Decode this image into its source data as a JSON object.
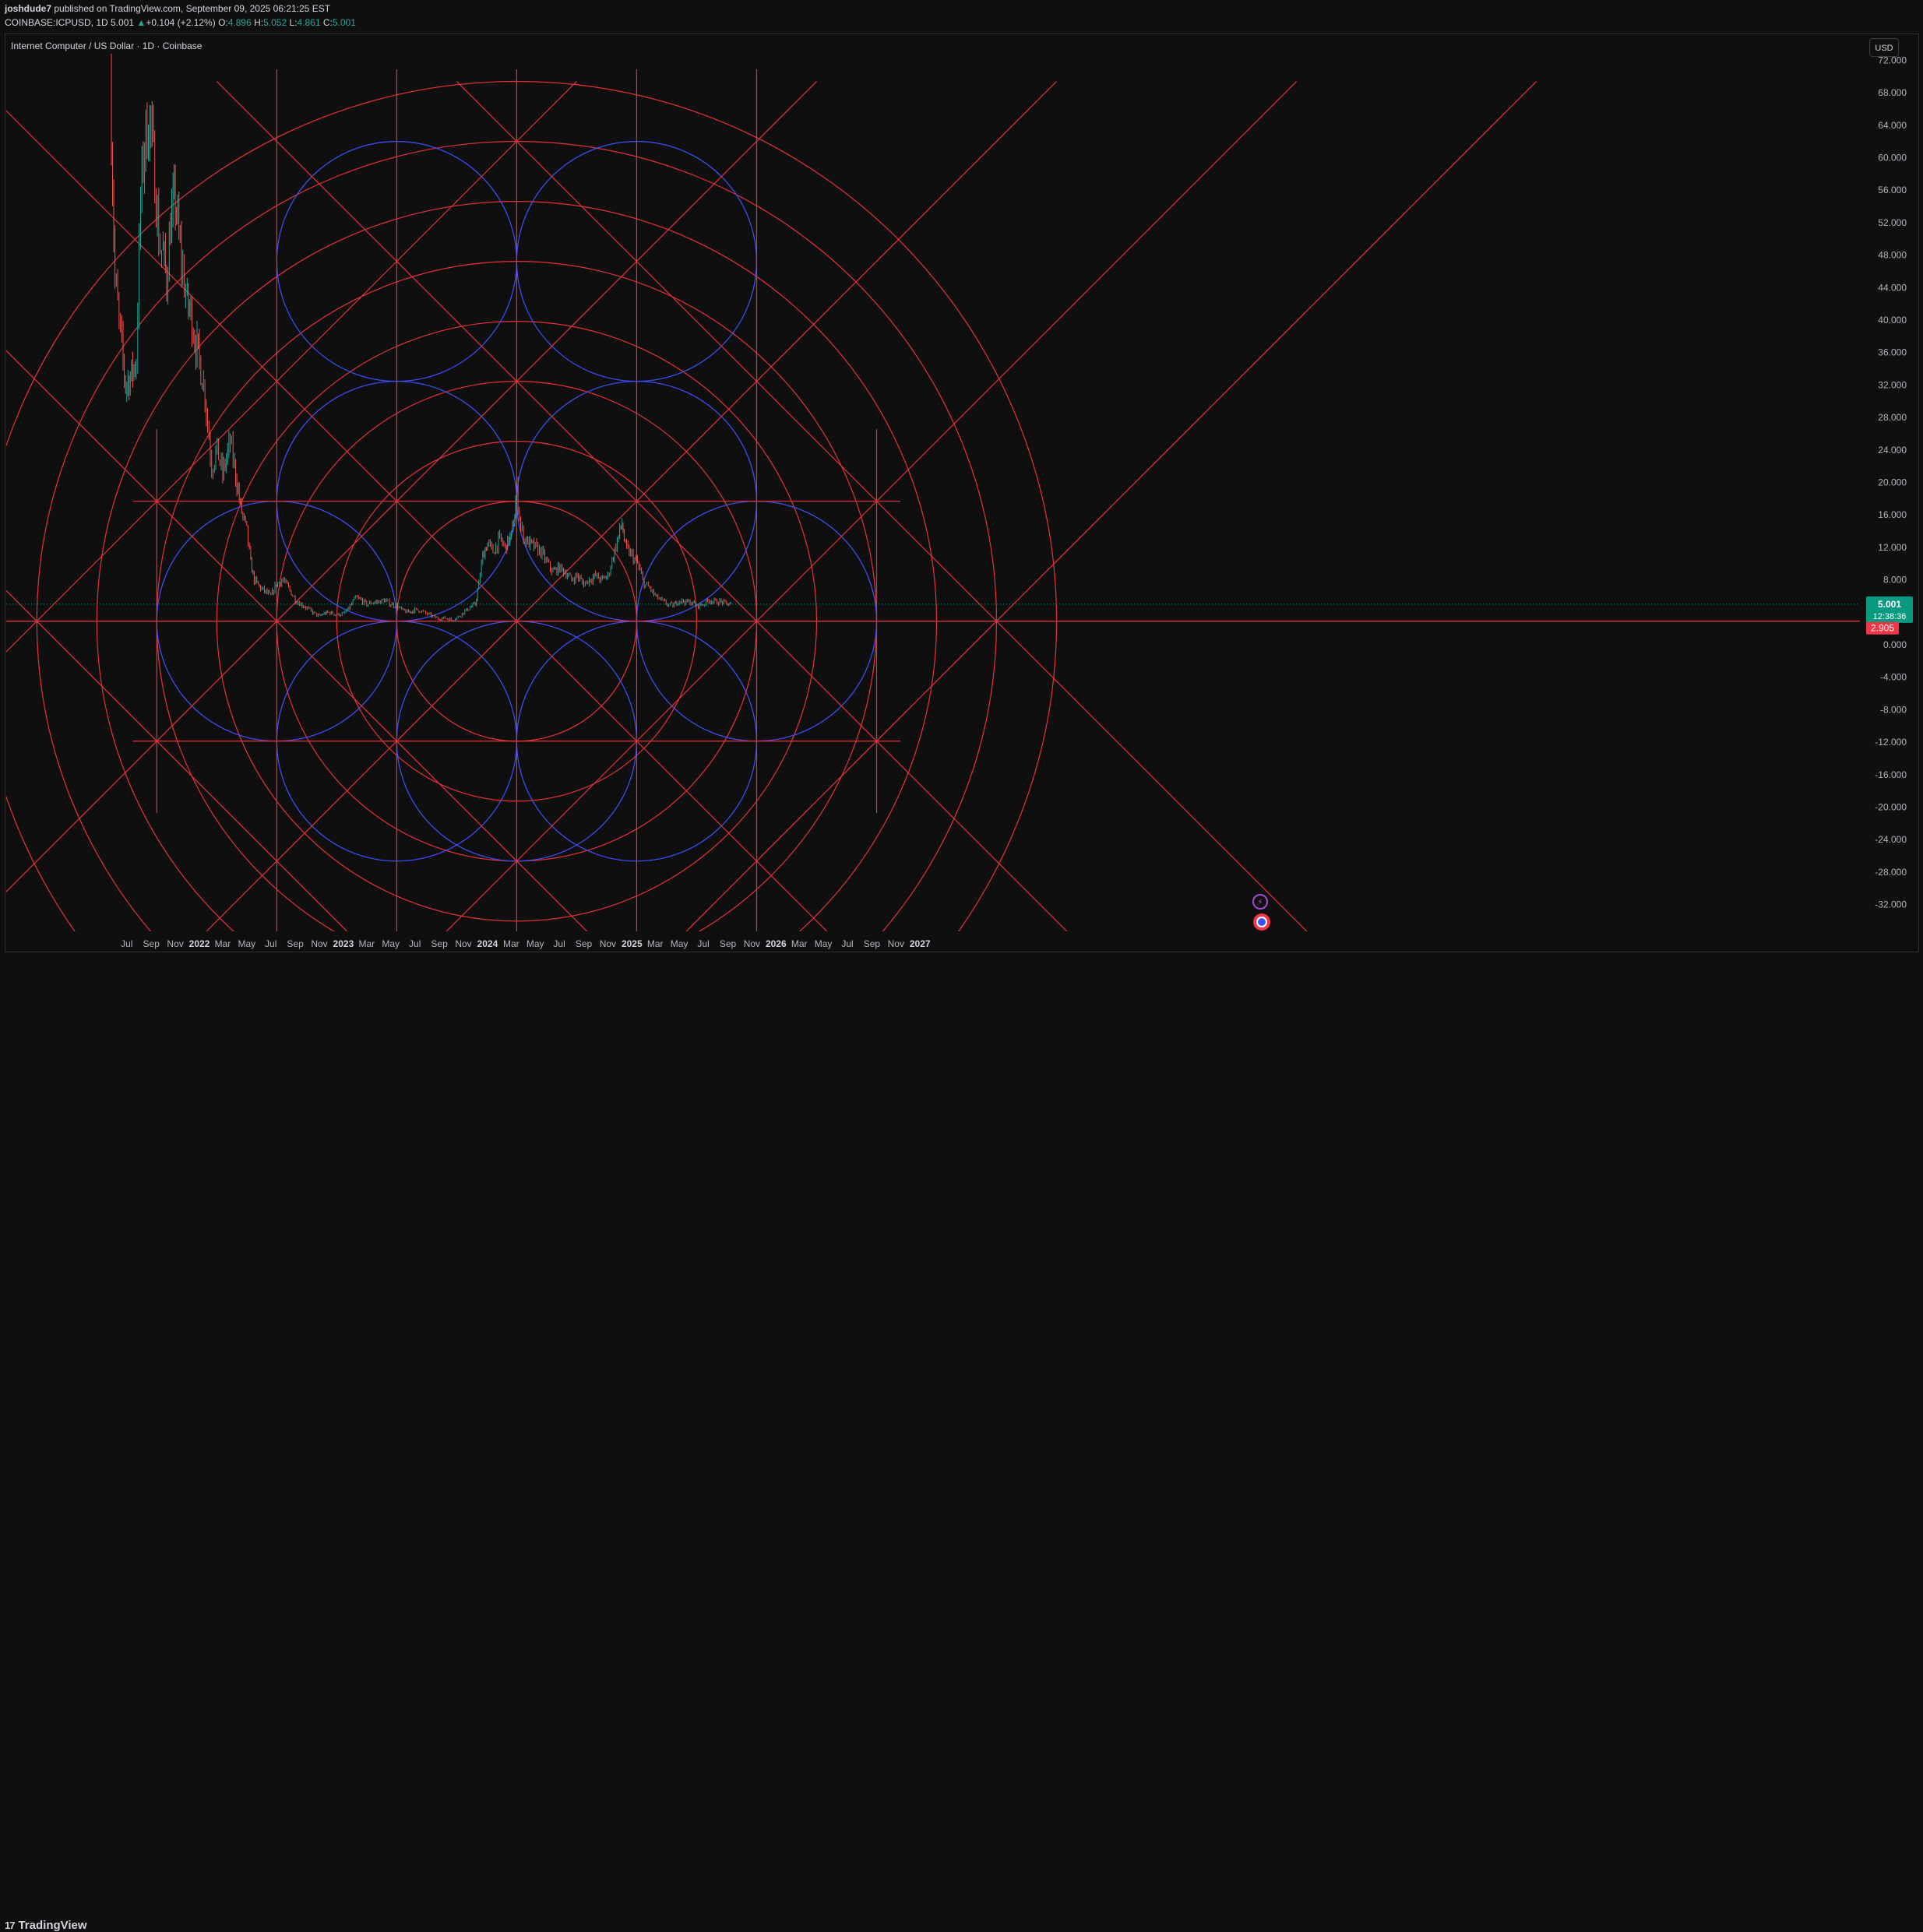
{
  "header": {
    "author": "joshdude7",
    "published_text": " published on TradingView.com, September 09, 2025 06:21:25 EST",
    "symbol_line": {
      "symbol": "COINBASE:ICPUSD, 1D",
      "last": "5.001",
      "change_arrow": "▲",
      "change": "+0.104 (+2.12%)",
      "o_label": "O:",
      "o": "4.896",
      "h_label": "H:",
      "h": "5.052",
      "l_label": "L:",
      "l": "4.861",
      "c_label": "C:",
      "c": "5.001"
    }
  },
  "legend_title": "Internet Computer / US Dollar · 1D · Coinbase",
  "currency_button": "USD",
  "footer": {
    "logo_mark": "17",
    "logo_text": "TradingView"
  },
  "colors": {
    "background": "#0f0f0f",
    "gann_red": "#e5323a",
    "gann_blue": "#3f51ff",
    "candle_up": "#26a69a",
    "candle_down": "#ef5350",
    "current_price": "#089981",
    "level_price": "#f23645"
  },
  "chart_data": {
    "type": "line",
    "subtype": "candlestick price with Gann square overlay",
    "title": "Internet Computer / US Dollar · 1D · Coinbase",
    "y_axis_side": "right",
    "ylim": [
      -34,
      74
    ],
    "y_ticks": [
      72,
      68,
      64,
      60,
      56,
      52,
      48,
      44,
      40,
      36,
      32,
      28,
      24,
      20,
      16,
      12,
      8,
      0,
      -4,
      -8,
      -12,
      -16,
      -20,
      -24,
      -28,
      -32
    ],
    "y_tick_labels": [
      "72.000",
      "68.000",
      "64.000",
      "60.000",
      "56.000",
      "52.000",
      "48.000",
      "44.000",
      "40.000",
      "36.000",
      "32.000",
      "28.000",
      "24.000",
      "20.000",
      "16.000",
      "12.000",
      "8.000",
      "0.000",
      "-4.000",
      "-8.000",
      "-12.000",
      "-16.000",
      "-20.000",
      "-24.000",
      "-28.000",
      "-32.000"
    ],
    "x_tick_labels": [
      "Jul",
      "Sep",
      "Nov",
      "2022",
      "Mar",
      "May",
      "Jul",
      "Sep",
      "Nov",
      "2023",
      "Mar",
      "May",
      "Jul",
      "Sep",
      "Nov",
      "2024",
      "Mar",
      "May",
      "Jul",
      "Sep",
      "Nov",
      "2025",
      "Mar",
      "May",
      "Jul",
      "Sep",
      "Nov",
      "2026",
      "Mar",
      "May",
      "Jul",
      "Sep",
      "Nov",
      "2027"
    ],
    "x_tick_months": [
      "2021-07",
      "2021-09",
      "2021-11",
      "2022-01",
      "2022-03",
      "2022-05",
      "2022-07",
      "2022-09",
      "2022-11",
      "2023-01",
      "2023-03",
      "2023-05",
      "2023-07",
      "2023-09",
      "2023-11",
      "2024-01",
      "2024-03",
      "2024-05",
      "2024-07",
      "2024-09",
      "2024-11",
      "2025-01",
      "2025-03",
      "2025-05",
      "2025-07",
      "2025-09",
      "2025-11",
      "2026-01",
      "2026-03",
      "2026-05",
      "2026-07",
      "2026-09",
      "2026-11",
      "2027-01"
    ],
    "price_series": {
      "name": "ICPUSD",
      "dates": [
        "2021-05-20",
        "2021-06-01",
        "2021-06-15",
        "2021-06-28",
        "2021-07-10",
        "2021-07-25",
        "2021-08-05",
        "2021-08-15",
        "2021-08-28",
        "2021-09-10",
        "2021-09-20",
        "2021-10-01",
        "2021-10-10",
        "2021-10-20",
        "2021-11-01",
        "2021-11-10",
        "2021-11-20",
        "2021-12-01",
        "2021-12-10",
        "2021-12-20",
        "2022-01-01",
        "2022-01-15",
        "2022-02-01",
        "2022-02-15",
        "2022-03-01",
        "2022-03-20",
        "2022-03-31",
        "2022-04-15",
        "2022-05-01",
        "2022-05-11",
        "2022-05-20",
        "2022-06-05",
        "2022-06-18",
        "2022-07-01",
        "2022-07-15",
        "2022-08-01",
        "2022-08-15",
        "2022-09-01",
        "2022-09-15",
        "2022-10-01",
        "2022-10-15",
        "2022-11-01",
        "2022-11-10",
        "2022-11-25",
        "2022-12-15",
        "2023-01-01",
        "2023-01-15",
        "2023-02-01",
        "2023-02-15",
        "2023-03-01",
        "2023-03-15",
        "2023-04-01",
        "2023-04-15",
        "2023-05-01",
        "2023-05-15",
        "2023-06-01",
        "2023-06-15",
        "2023-07-01",
        "2023-07-15",
        "2023-08-01",
        "2023-08-15",
        "2023-09-01",
        "2023-09-15",
        "2023-10-01",
        "2023-10-15",
        "2023-11-01",
        "2023-11-15",
        "2023-12-01",
        "2023-12-10",
        "2023-12-20",
        "2024-01-01",
        "2024-01-15",
        "2024-02-01",
        "2024-02-15",
        "2024-03-01",
        "2024-03-10",
        "2024-03-15",
        "2024-03-25",
        "2024-04-05",
        "2024-04-15",
        "2024-05-01",
        "2024-05-15",
        "2024-06-01",
        "2024-06-15",
        "2024-07-01",
        "2024-07-15",
        "2024-08-01",
        "2024-08-15",
        "2024-09-01",
        "2024-09-15",
        "2024-10-01",
        "2024-10-15",
        "2024-11-01",
        "2024-11-15",
        "2024-12-01",
        "2024-12-07",
        "2024-12-15",
        "2025-01-01",
        "2025-01-15",
        "2025-02-01",
        "2025-02-15",
        "2025-03-01",
        "2025-03-15",
        "2025-04-01",
        "2025-04-15",
        "2025-05-01",
        "2025-05-15",
        "2025-06-01",
        "2025-06-15",
        "2025-07-01",
        "2025-07-15",
        "2025-08-01",
        "2025-08-15",
        "2025-09-01",
        "2025-09-09"
      ],
      "close": [
        70,
        45,
        38,
        32,
        33,
        35,
        55,
        62,
        65,
        58,
        50,
        48,
        45,
        52,
        55,
        50,
        46,
        42,
        41,
        38,
        35,
        31,
        22,
        24,
        21,
        25,
        22,
        17,
        14,
        10,
        8,
        7,
        6.5,
        6,
        7.5,
        8,
        7,
        5.5,
        5,
        4.5,
        4,
        3.5,
        3.8,
        4,
        3.7,
        3.8,
        4.5,
        5.8,
        5.5,
        5,
        5.2,
        5.3,
        5.5,
        5,
        4.8,
        4.2,
        4,
        4.3,
        4.2,
        3.8,
        3.5,
        3.2,
        3.3,
        3.1,
        3.3,
        4,
        4.5,
        5,
        7.5,
        11,
        12.5,
        11.5,
        13,
        12,
        13.5,
        16,
        19,
        14.5,
        13,
        12.5,
        12,
        11.5,
        10,
        9,
        9.5,
        9,
        8,
        8.5,
        7.5,
        8,
        8.5,
        8,
        8.5,
        11,
        14,
        15,
        12,
        11,
        10,
        7.5,
        7,
        6,
        5.5,
        5,
        4.8,
        5.5,
        5.3,
        5.2,
        4.8,
        5,
        5.5,
        5.3,
        5.3,
        5,
        5.001
      ]
    },
    "price_labels": [
      {
        "label": "5.001",
        "value": 5.001,
        "sub_label": "12:38:36",
        "role": "last price"
      },
      {
        "label": "2.905",
        "value": 2.905,
        "role": "horizontal line level"
      }
    ],
    "gann_overlay": {
      "center": {
        "date": "2024-03-15",
        "price": 2.905
      },
      "radius_unit": {
        "days": 304,
        "price": 17.6
      },
      "red_circles_radius_units": [
        1,
        1.5,
        2,
        2.5,
        3,
        3.5,
        4,
        4.5
      ],
      "blue_circle_centers_units": [
        [
          -1,
          1
        ],
        [
          1,
          1
        ],
        [
          -1,
          3
        ],
        [
          1,
          3
        ],
        [
          -2,
          0
        ],
        [
          2,
          0
        ],
        [
          0,
          -1
        ],
        [
          -1,
          -1
        ],
        [
          1,
          -1
        ]
      ],
      "blue_circle_radius_units": 1
    },
    "grid": false,
    "legend": "top-left"
  }
}
